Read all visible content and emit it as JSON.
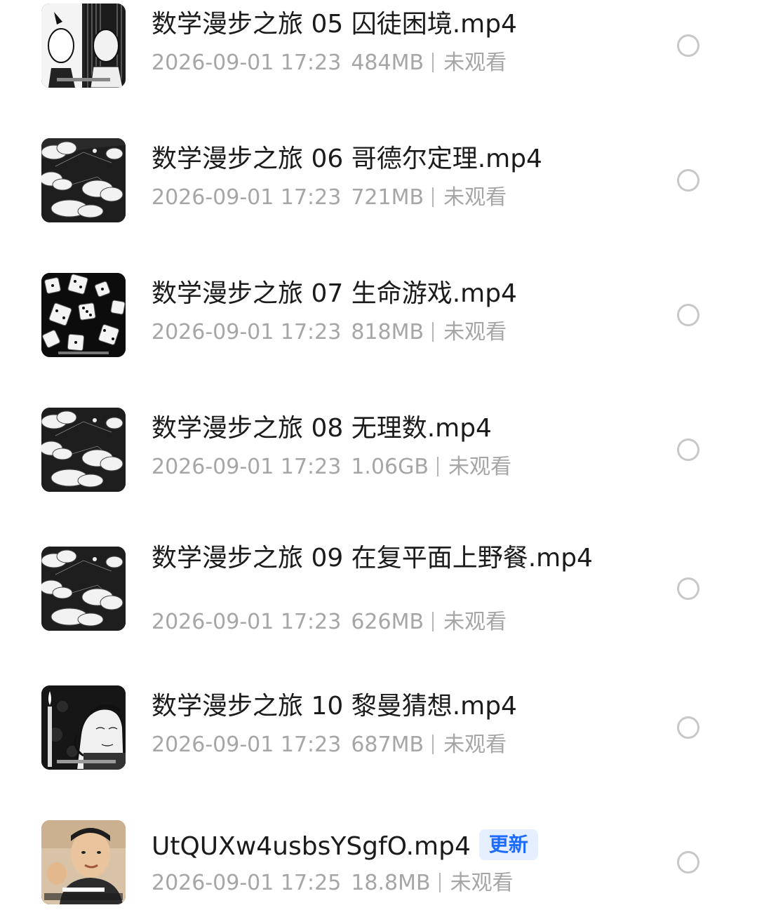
{
  "files": [
    {
      "name": "数学漫步之旅 05 囚徒困境.mp4",
      "date": "2026-09-01 17:23",
      "size": "484MB",
      "status": "未观看",
      "badge": null,
      "thumb_icon": "portraits-thumbnail-icon"
    },
    {
      "name": "数学漫步之旅 06 哥德尔定理.mp4",
      "date": "2026-09-01 17:23",
      "size": "721MB",
      "status": "未观看",
      "badge": null,
      "thumb_icon": "clouds-thumbnail-icon"
    },
    {
      "name": "数学漫步之旅 07 生命游戏.mp4",
      "date": "2026-09-01 17:23",
      "size": "818MB",
      "status": "未观看",
      "badge": null,
      "thumb_icon": "dice-thumbnail-icon"
    },
    {
      "name": "数学漫步之旅 08 无理数.mp4",
      "date": "2026-09-01 17:23",
      "size": "1.06GB",
      "status": "未观看",
      "badge": null,
      "thumb_icon": "clouds-thumbnail-icon"
    },
    {
      "name": "数学漫步之旅 09 在复平面上野餐.mp4",
      "date": "2026-09-01 17:23",
      "size": "626MB",
      "status": "未观看",
      "badge": null,
      "thumb_icon": "clouds-thumbnail-icon"
    },
    {
      "name": "数学漫步之旅 10 黎曼猜想.mp4",
      "date": "2026-09-01 17:23",
      "size": "687MB",
      "status": "未观看",
      "badge": null,
      "thumb_icon": "candle-thumbnail-icon"
    },
    {
      "name": "UtQUXw4usbsYSgfO.mp4",
      "date": "2026-09-01 17:25",
      "size": "18.8MB",
      "status": "未观看",
      "badge": "更新",
      "thumb_icon": "person-thumbnail-icon"
    }
  ],
  "colors": {
    "title": "#1b1b1b",
    "meta": "#a6a6a6",
    "radio_border": "#c8c8c8",
    "badge_bg": "#e6efff",
    "badge_text": "#1e6bff"
  }
}
